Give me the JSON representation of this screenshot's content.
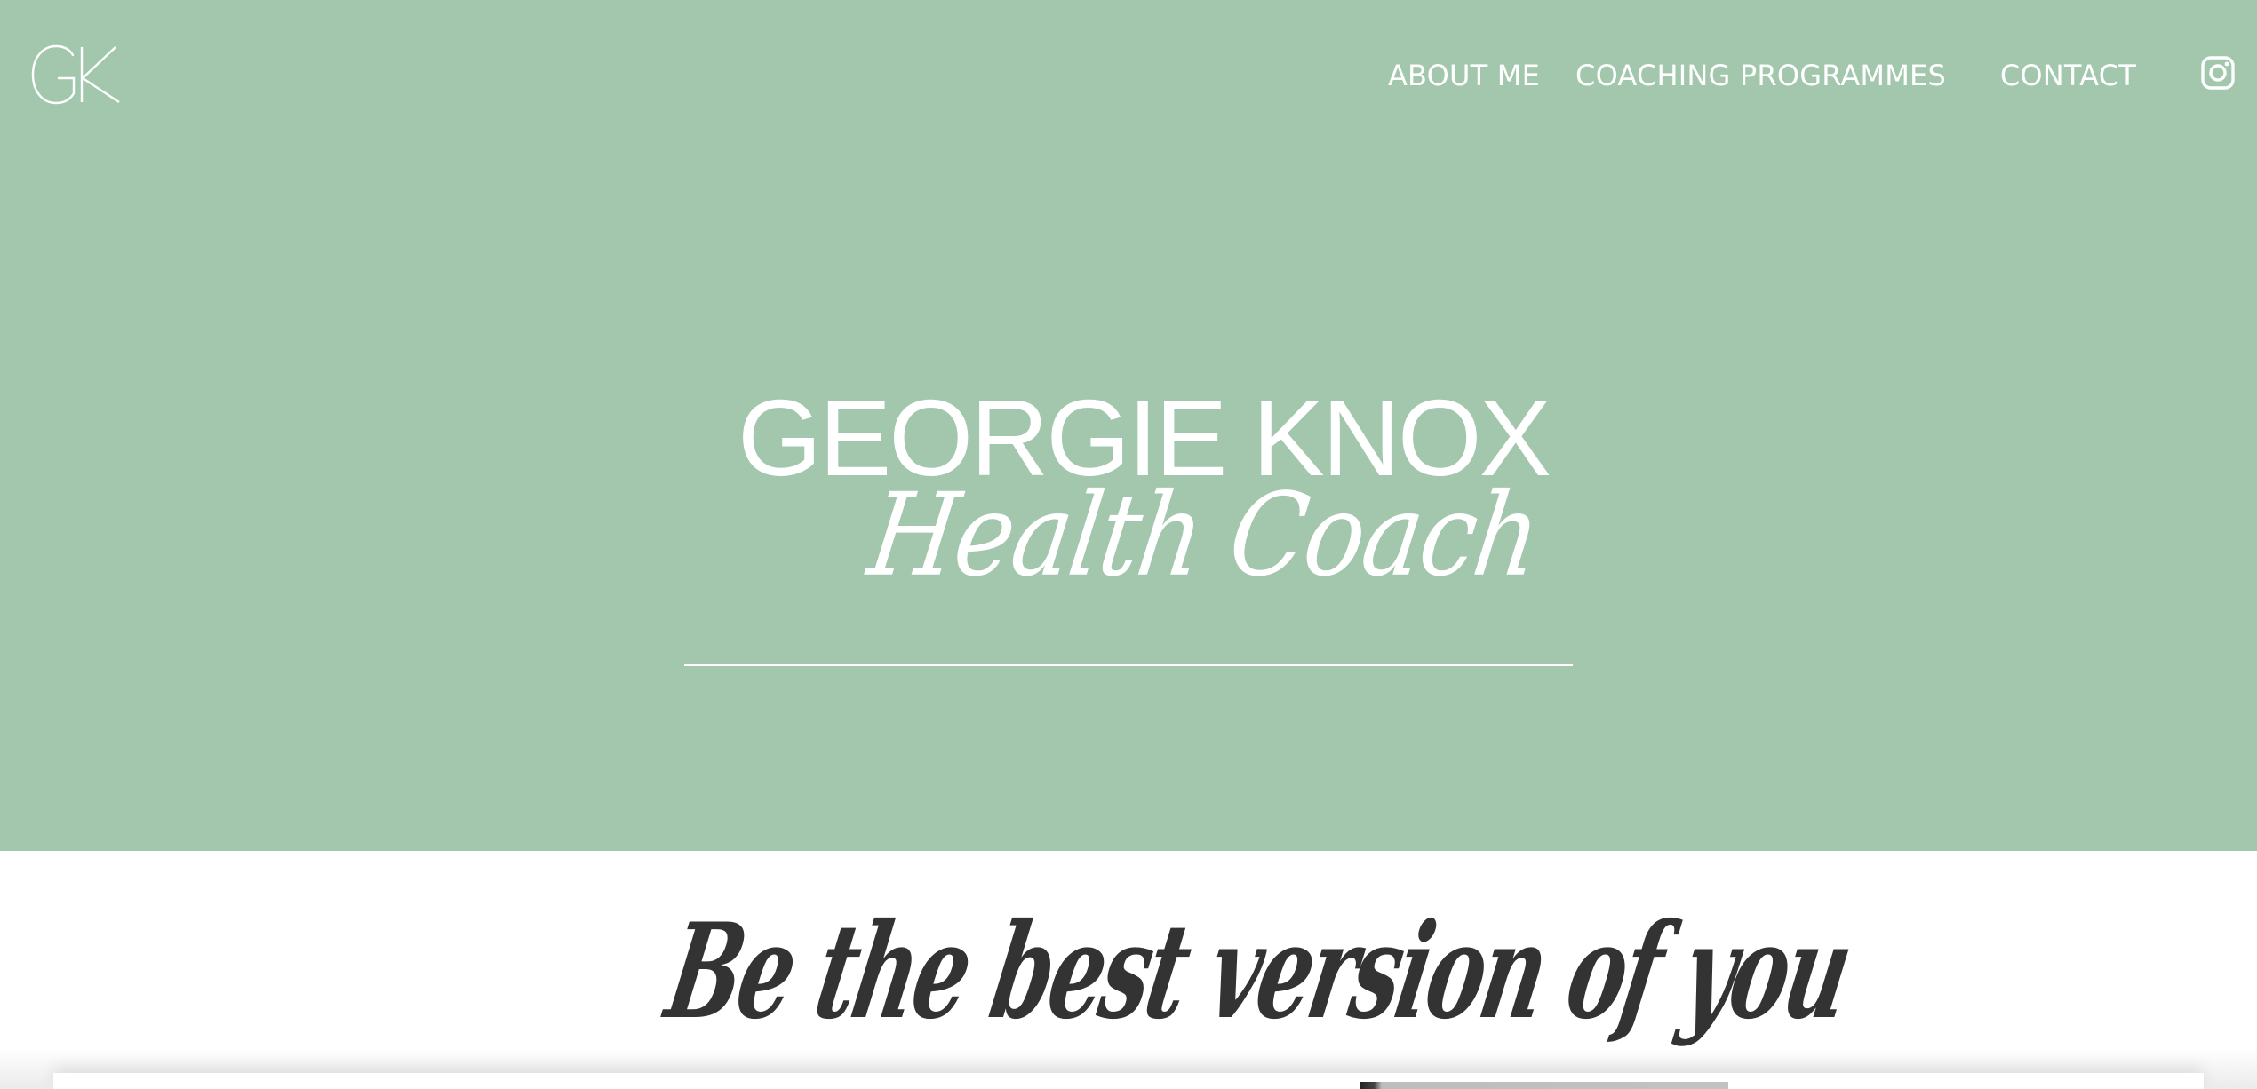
{
  "header": {
    "logo": "GK",
    "nav": {
      "about": "ABOUT ME",
      "coaching": "COACHING PROGRAMMES",
      "contact": "CONTACT"
    },
    "social_icon": "instagram-icon"
  },
  "hero": {
    "brand_name": "GEORGIE KNOX",
    "brand_tagline": "Health Coach"
  },
  "section": {
    "tagline": "Be the best version of you"
  },
  "colors": {
    "hero_background": "#a2c7ad",
    "hero_text": "#ffffff",
    "tagline_text": "#333333",
    "page_background": "#ffffff"
  }
}
